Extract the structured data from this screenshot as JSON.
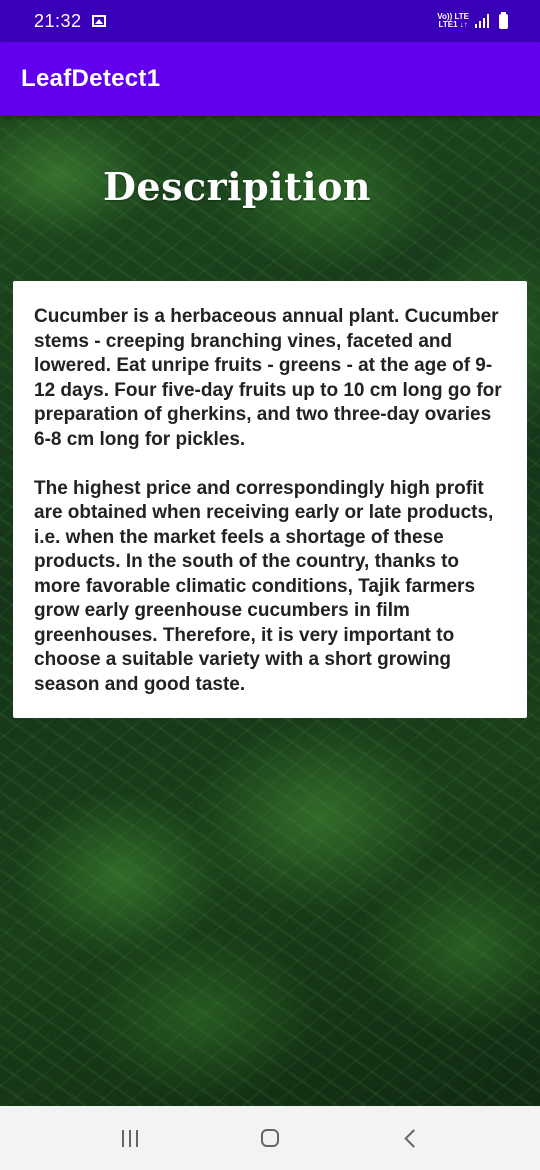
{
  "status_bar": {
    "time": "21:32",
    "network_top": "Vo)) LTE",
    "network_bottom": "LTE1 ↓↑",
    "icons": [
      "gallery-icon",
      "signal-icon",
      "battery-icon"
    ]
  },
  "app_bar": {
    "title": "LeafDetect1",
    "color": "#6200ee",
    "status_color": "#3a00b8"
  },
  "main": {
    "heading": "Descripition",
    "paragraphs": [
      "Cucumber is a herbaceous annual plant. Cucumber stems - creeping branching vines, faceted and lowered. Eat unripe fruits - greens - at the age of 9-12 days. Four five-day fruits up to 10 cm long go for preparation of gherkins, and two three-day ovaries 6-8 cm long for pickles.",
      "The highest price and correspondingly high profit are obtained when receiving early or late products, i.e. when the market feels a shortage of these products. In the south of the country, thanks to more favorable climatic conditions, Tajik farmers grow early greenhouse cucumbers in film greenhouses. Therefore, it is very important to choose a suitable variety with a short growing season and good taste."
    ],
    "background": "fern-leaves-photo"
  },
  "nav_bar": {
    "buttons": [
      "recents-icon",
      "home-icon",
      "back-icon"
    ]
  }
}
